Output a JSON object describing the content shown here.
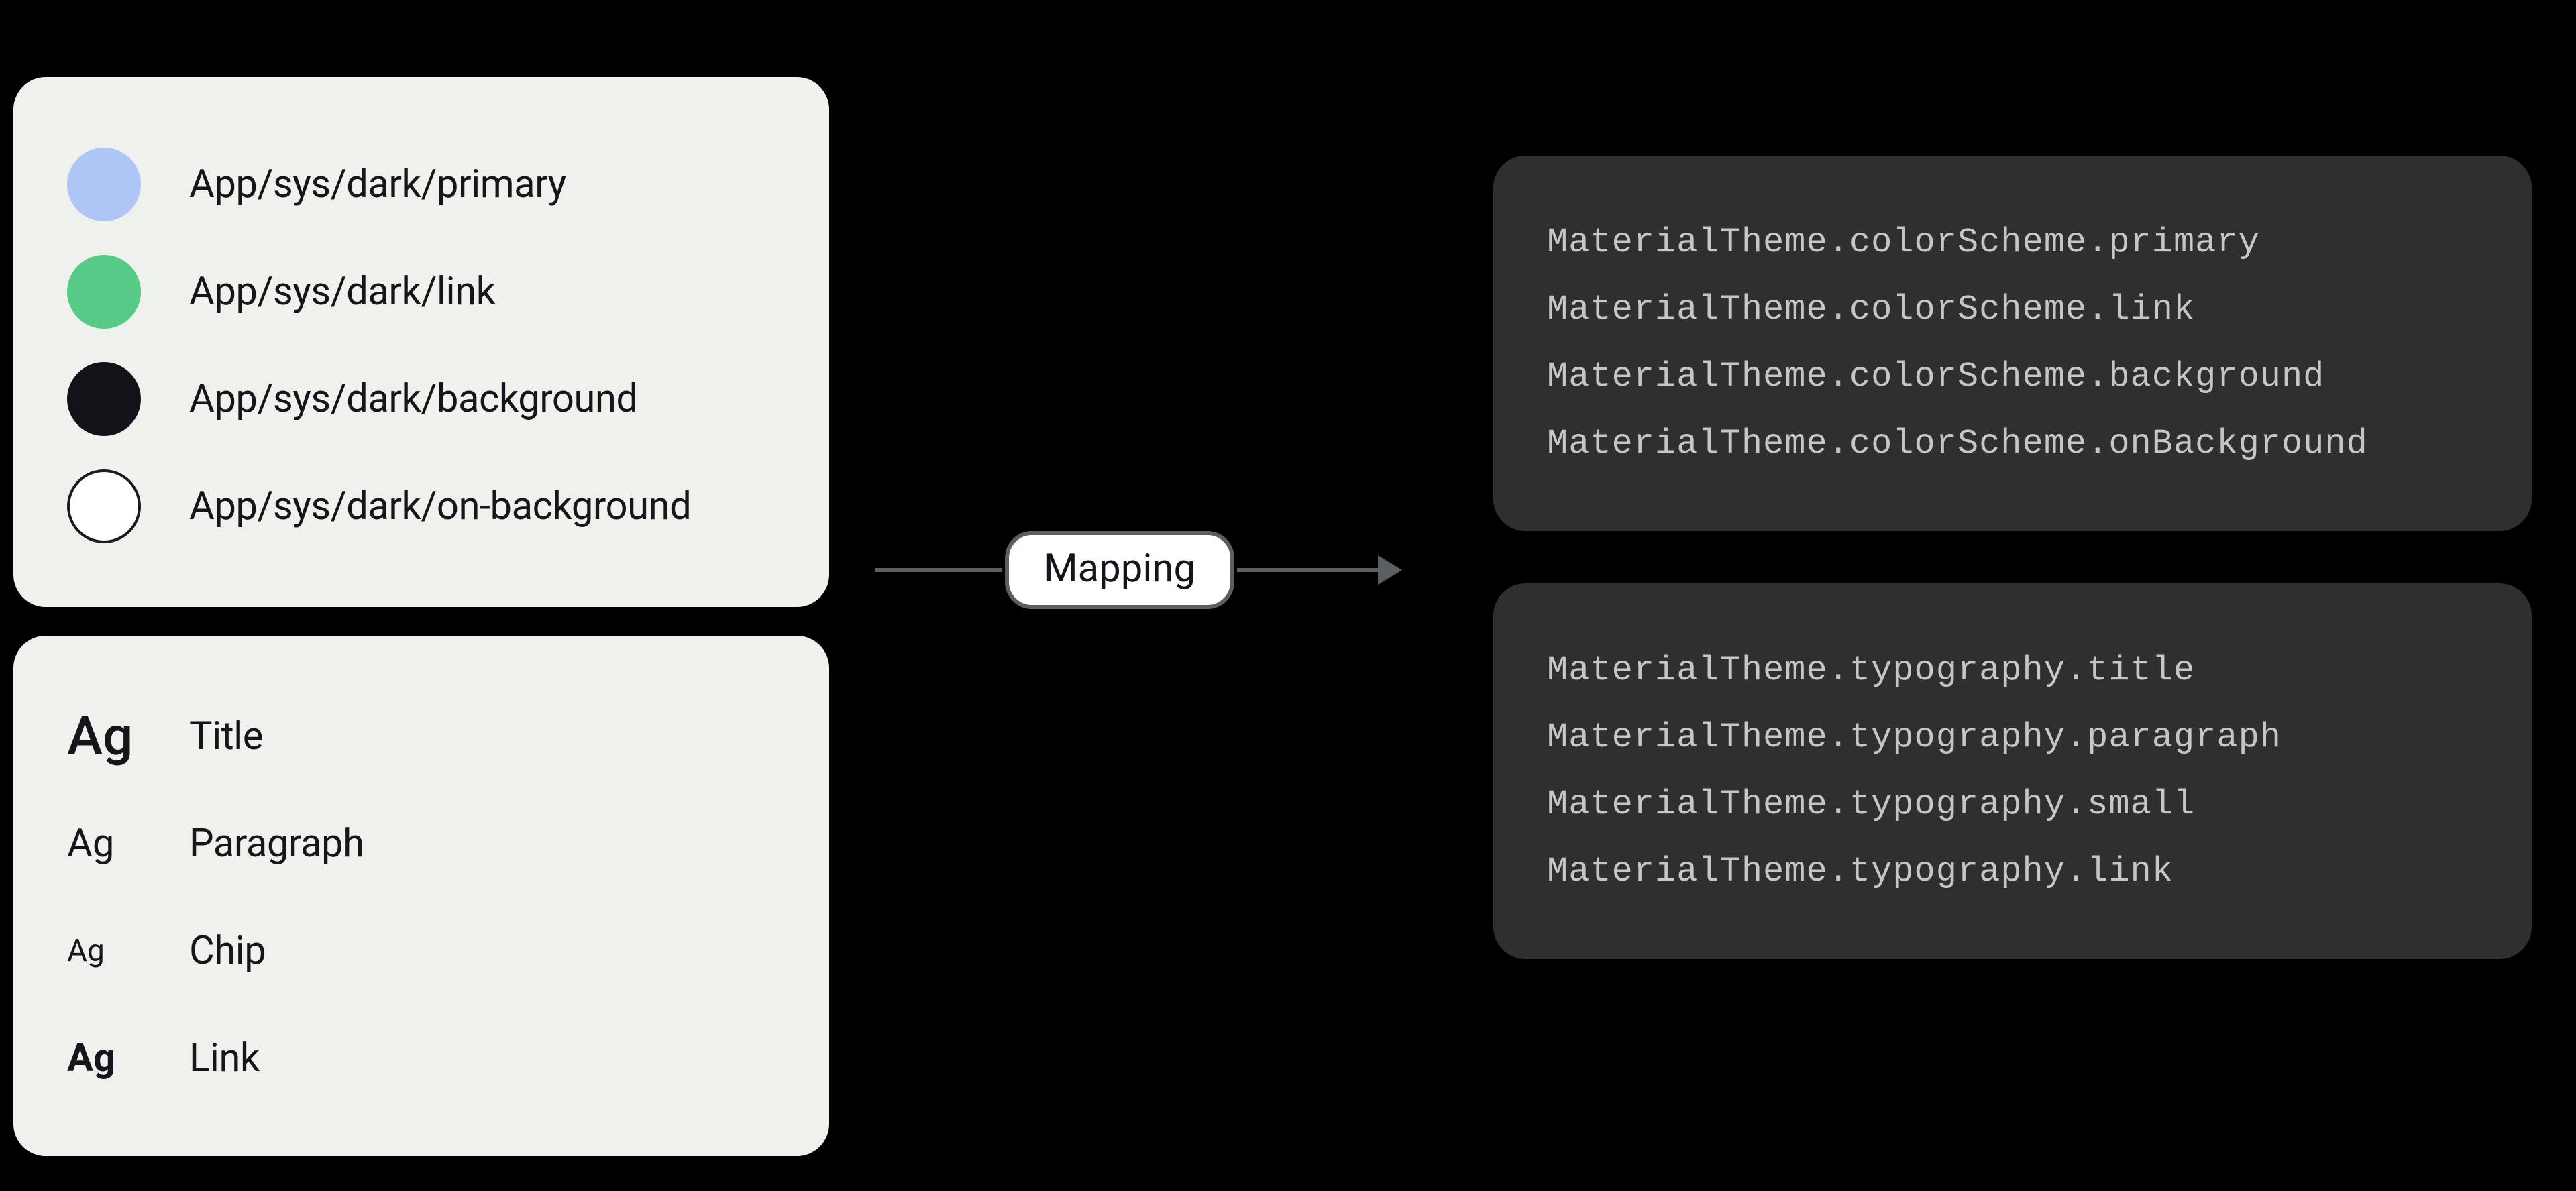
{
  "mapping_label": "Mapping",
  "sample_glyph": "Ag",
  "colors": {
    "items": [
      {
        "label": "App/sys/dark/primary",
        "hex": "#aec6f6",
        "border": false
      },
      {
        "label": "App/sys/dark/link",
        "hex": "#56ca87",
        "border": false
      },
      {
        "label": "App/sys/dark/background",
        "hex": "#111318",
        "border": false
      },
      {
        "label": "App/sys/dark/on-background",
        "hex": "#ffffff",
        "border": true
      }
    ]
  },
  "typography": {
    "items": [
      {
        "label": "Title",
        "style": "typo-title"
      },
      {
        "label": "Paragraph",
        "style": "typo-para"
      },
      {
        "label": "Chip",
        "style": "typo-chip"
      },
      {
        "label": "Link",
        "style": "typo-link"
      }
    ]
  },
  "code_colors": {
    "lines": [
      "MaterialTheme.colorScheme.primary",
      "MaterialTheme.colorScheme.link",
      "MaterialTheme.colorScheme.background",
      "MaterialTheme.colorScheme.onBackground"
    ]
  },
  "code_typo": {
    "lines": [
      "MaterialTheme.typography.title",
      "MaterialTheme.typography.paragraph",
      "MaterialTheme.typography.small",
      "MaterialTheme.typography.link"
    ]
  }
}
